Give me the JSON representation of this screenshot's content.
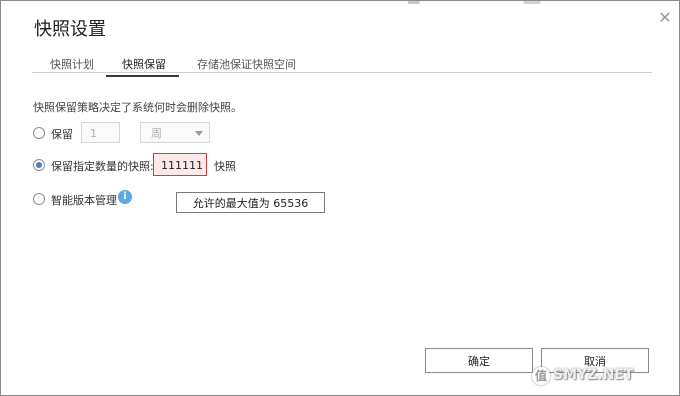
{
  "dialog": {
    "title": "快照设置",
    "close_icon": "close-icon"
  },
  "tabs": [
    {
      "label": "快照计划",
      "active": false
    },
    {
      "label": "快照保留",
      "active": true
    },
    {
      "label": "存储池保证快照空间",
      "active": false
    }
  ],
  "retention": {
    "description": "快照保留策略决定了系统何时会删除快照。",
    "option_keep": {
      "label": "保留",
      "value_placeholder": "1",
      "unit_select": "周",
      "selected": false
    },
    "option_count": {
      "label": "保留指定数量的快照:",
      "value": "111111",
      "unit": "快照",
      "selected": true
    },
    "option_smart": {
      "label": "智能版本管理",
      "info_icon": "info-icon",
      "info_glyph": "i",
      "selected": false
    },
    "tooltip": "允许的最大值为 65536"
  },
  "buttons": {
    "ok": "确定",
    "cancel": "取消"
  },
  "watermark": {
    "text": "SMYZ.NET",
    "logo_glyph": "值"
  },
  "colors": {
    "accent": "#4a7fc0",
    "error_border": "#c94040",
    "error_fill": "#fde9e9",
    "info": "#5aa8e6"
  }
}
